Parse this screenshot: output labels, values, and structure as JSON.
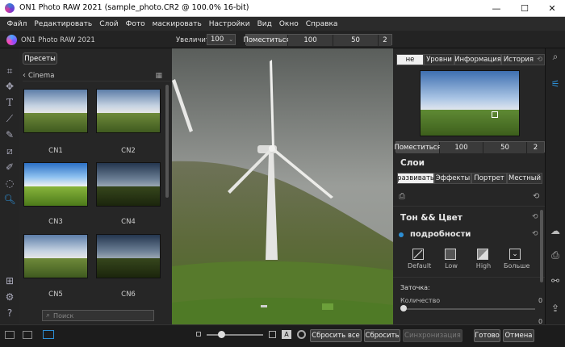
{
  "window": {
    "title": "ON1 Photo RAW 2021 (sample_photo.CR2 @ 100.0% 16-bit)",
    "minimize": "—",
    "maximize": "☐",
    "close": "✕"
  },
  "menu": [
    "Файл",
    "Редактировать",
    "Слой",
    "Фото",
    "маскировать",
    "Настройки",
    "Вид",
    "Окно",
    "Справка"
  ],
  "toolbar": {
    "app_name": "ON1 Photo RAW 2021",
    "zoom_label": "Увеличить",
    "zoom_value": "100",
    "fit_label": "Поместиться",
    "fit_options": [
      "100",
      "50",
      "2"
    ]
  },
  "browser": {
    "presets_button": "Пресеты",
    "category": "Cinema",
    "presets": [
      {
        "label": "CN1",
        "style": "normal"
      },
      {
        "label": "CN2",
        "style": "normal"
      },
      {
        "label": "CN3",
        "style": "bright"
      },
      {
        "label": "CN4",
        "style": "dark"
      },
      {
        "label": "CN5",
        "style": "normal"
      },
      {
        "label": "CN6",
        "style": "dark"
      }
    ],
    "search_placeholder": "Поиск"
  },
  "right_panel": {
    "top_tabs": [
      "не",
      "Уровни",
      "Информация",
      "История"
    ],
    "nav_fit_label": "Поместиться",
    "nav_options": [
      "100",
      "50",
      "2"
    ],
    "layers_title": "Слои",
    "edit_tabs": [
      "развивать",
      "Эффекты",
      "Портрет",
      "Местный"
    ],
    "tone_color_title": "Тон && Цвет",
    "details_title": "подробности",
    "detail_presets": [
      "Default",
      "Low",
      "High",
      "Больше"
    ],
    "sharpening_title": "Заточка:",
    "amount_label": "Количество",
    "amount_value": "0",
    "radius_value": "0"
  },
  "bottom": {
    "reset_all": "Сбросить все",
    "reset": "Сбросить",
    "sync": "Синхронизация",
    "done": "Готово",
    "cancel": "Отмена"
  },
  "colors": {
    "accent": "#2d8fd5",
    "panel": "#262626",
    "background": "#1e1e1e"
  }
}
